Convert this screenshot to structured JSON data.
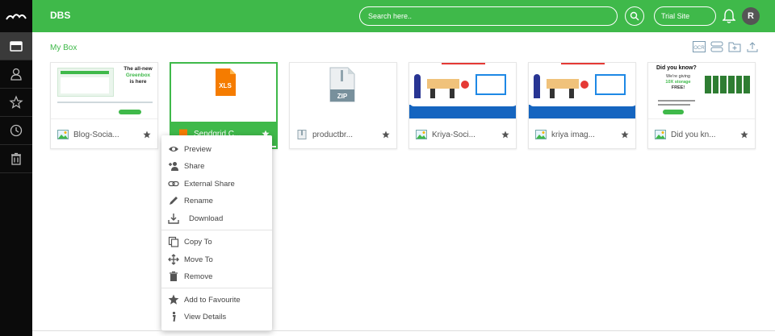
{
  "header": {
    "title": "DBS",
    "search_placeholder": "Search here..",
    "trial_label": "Trial Site",
    "avatar_initial": "R",
    "accent": "#3fb94a"
  },
  "sidebar": {
    "items": [
      {
        "icon": "box-icon",
        "active": true
      },
      {
        "icon": "user-icon"
      },
      {
        "icon": "star-icon"
      },
      {
        "icon": "clock-icon"
      },
      {
        "icon": "trash-icon"
      }
    ]
  },
  "breadcrumb": "My Box",
  "toolbar": {
    "icons": [
      "ocr-icon",
      "list-view-icon",
      "new-folder-icon",
      "upload-icon"
    ],
    "ocr_label": "OCR"
  },
  "files": [
    {
      "name": "Blog-Socia...",
      "type": "image",
      "thumb_text": [
        "The all-new",
        "Greenbox",
        "is here"
      ]
    },
    {
      "name": "Sendgrid C...",
      "type": "xls",
      "thumb_text": [
        "XLS"
      ]
    },
    {
      "name": "productbr...",
      "type": "zip",
      "thumb_text": [
        "ZIP"
      ]
    },
    {
      "name": "Kriya-Soci...",
      "type": "image"
    },
    {
      "name": "kriya imag...",
      "type": "image"
    },
    {
      "name": "Did you kn...",
      "type": "image",
      "thumb_text": [
        "Did you know?",
        "We're giving",
        "10X storage",
        "FREE!"
      ]
    }
  ],
  "context_menu": {
    "groups": [
      [
        {
          "label": "Preview",
          "icon": "eye-icon"
        },
        {
          "label": "Share",
          "icon": "share-user-icon"
        },
        {
          "label": "External Share",
          "icon": "link-icon"
        },
        {
          "label": "Rename",
          "icon": "pencil-icon"
        },
        {
          "label": "Download",
          "icon": "download-icon"
        }
      ],
      [
        {
          "label": "Copy To",
          "icon": "copy-icon"
        },
        {
          "label": "Move To",
          "icon": "move-icon"
        },
        {
          "label": "Remove",
          "icon": "trash-icon"
        }
      ],
      [
        {
          "label": "Add to Favourite",
          "icon": "star-icon"
        },
        {
          "label": "View Details",
          "icon": "info-icon"
        }
      ]
    ]
  }
}
